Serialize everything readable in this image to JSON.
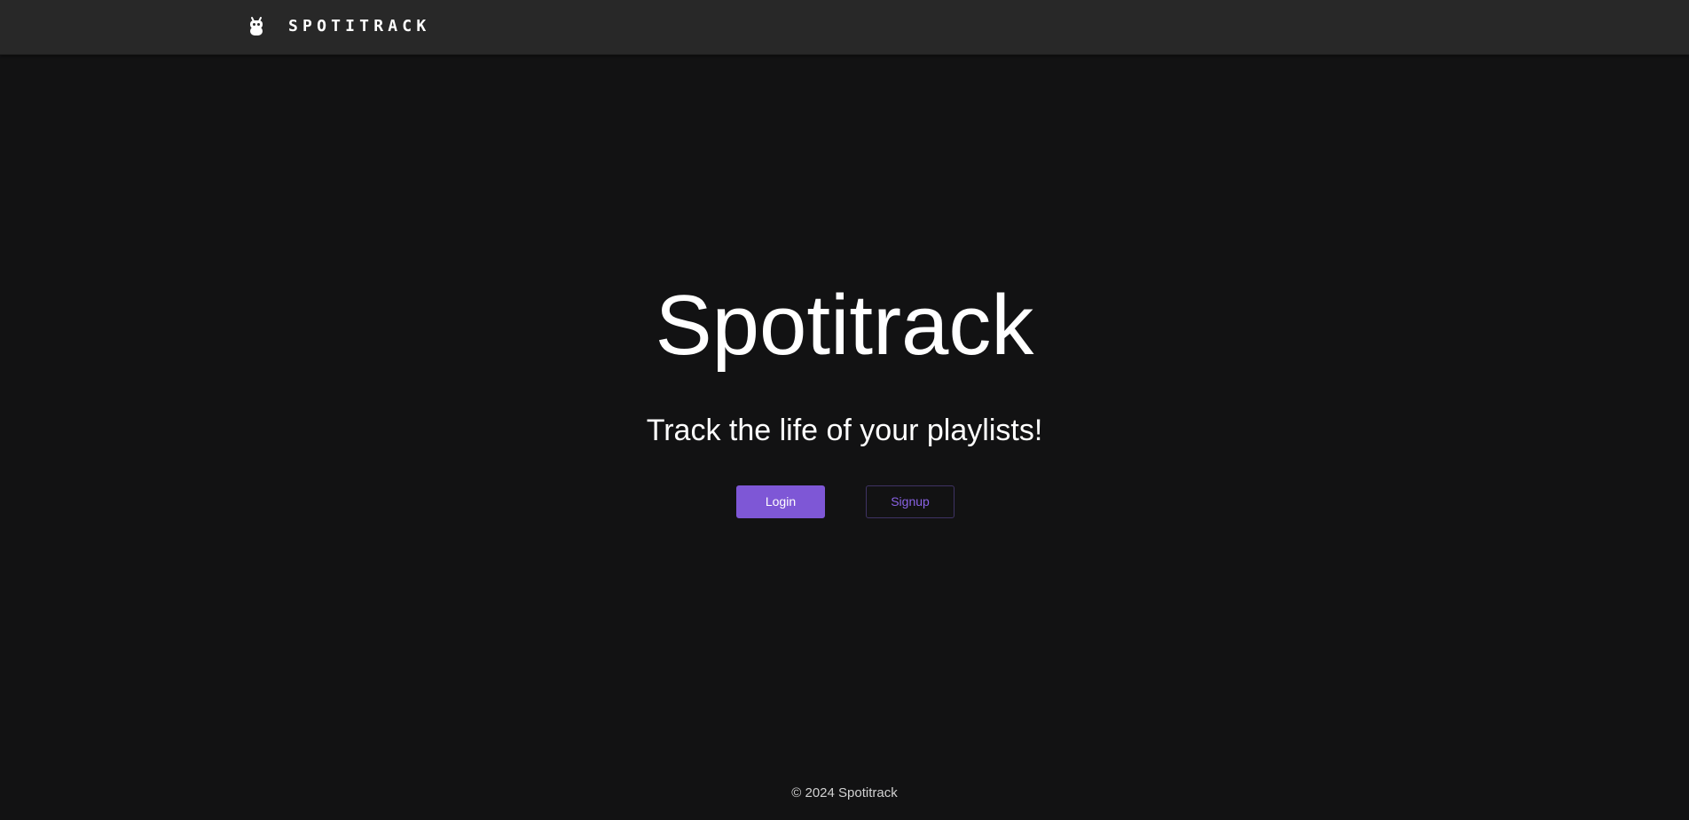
{
  "navbar": {
    "brand_icon": "robot-head-icon",
    "brand_text": "SPOTITRACK"
  },
  "hero": {
    "title": "Spotitrack",
    "subtitle": "Track the life of your playlists!",
    "login_label": "Login",
    "signup_label": "Signup"
  },
  "footer": {
    "text": "© 2024 Spotitrack"
  },
  "colors": {
    "background": "#121213",
    "navbar": "#282828",
    "accent": "#7e57d6",
    "signup_text": "#8a63e6"
  }
}
